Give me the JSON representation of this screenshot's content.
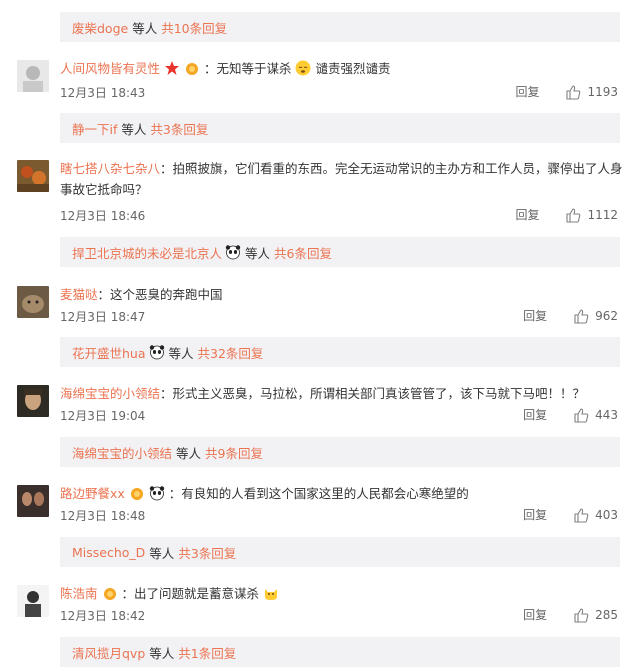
{
  "reply_bars": [
    {
      "name": "废柴doge",
      "mid": "等人",
      "more": "共10条回复"
    },
    {
      "name": "静一下if",
      "mid": "等人",
      "more": "共3条回复"
    },
    {
      "name": "捍卫北京城的未必是北京人",
      "mid": "等人",
      "more": "共6条回复"
    },
    {
      "name": "花开盛世hua",
      "mid": "等人",
      "more": "共32条回复"
    },
    {
      "name": "海绵宝宝的小领结",
      "mid": "等人",
      "more": "共9条回复"
    },
    {
      "name": "Missecho_D",
      "mid": "等人",
      "more": "共3条回复"
    },
    {
      "name": "清风揽月qvp",
      "mid": "等人",
      "more": "共1条回复"
    }
  ],
  "comments": [
    {
      "user": "人间风物皆有灵性",
      "text_a": "：无知等于谋杀",
      "text_b": "谴责强烈谴责",
      "time": "12月3日 18:43",
      "reply": "回复",
      "likes": "1193"
    },
    {
      "user": "瞎七搭八杂七杂八",
      "text_a": "：拍照披旗，它们看重的东西。完全无运动常识的主办方和工作人员，骤停出了人身事故它抵命吗？",
      "time": "12月3日 18:46",
      "reply": "回复",
      "likes": "1112"
    },
    {
      "user": "麦猫哒",
      "text_a": "：这个恶臭的奔跑中国",
      "time": "12月3日 18:47",
      "reply": "回复",
      "likes": "962"
    },
    {
      "user": "海绵宝宝的小领结",
      "text_a": "：形式主义恶臭，马拉松，所谓相关部门真该管管了，该下马就下马吧！！？",
      "time": "12月3日 19:04",
      "reply": "回复",
      "likes": "443"
    },
    {
      "user": "路边野餐xx",
      "text_a": "：有良知的人看到这个国家这里的人民都会心寒绝望的",
      "time": "12月3日 18:48",
      "reply": "回复",
      "likes": "403"
    },
    {
      "user": "陈浩南",
      "text_a": "：出了问题就是蓄意谋杀",
      "time": "12月3日 18:42",
      "reply": "回复",
      "likes": "285"
    }
  ],
  "colors": {
    "username": "#eb7350",
    "reply_bg": "#f2f2f5",
    "meta": "#666666"
  }
}
